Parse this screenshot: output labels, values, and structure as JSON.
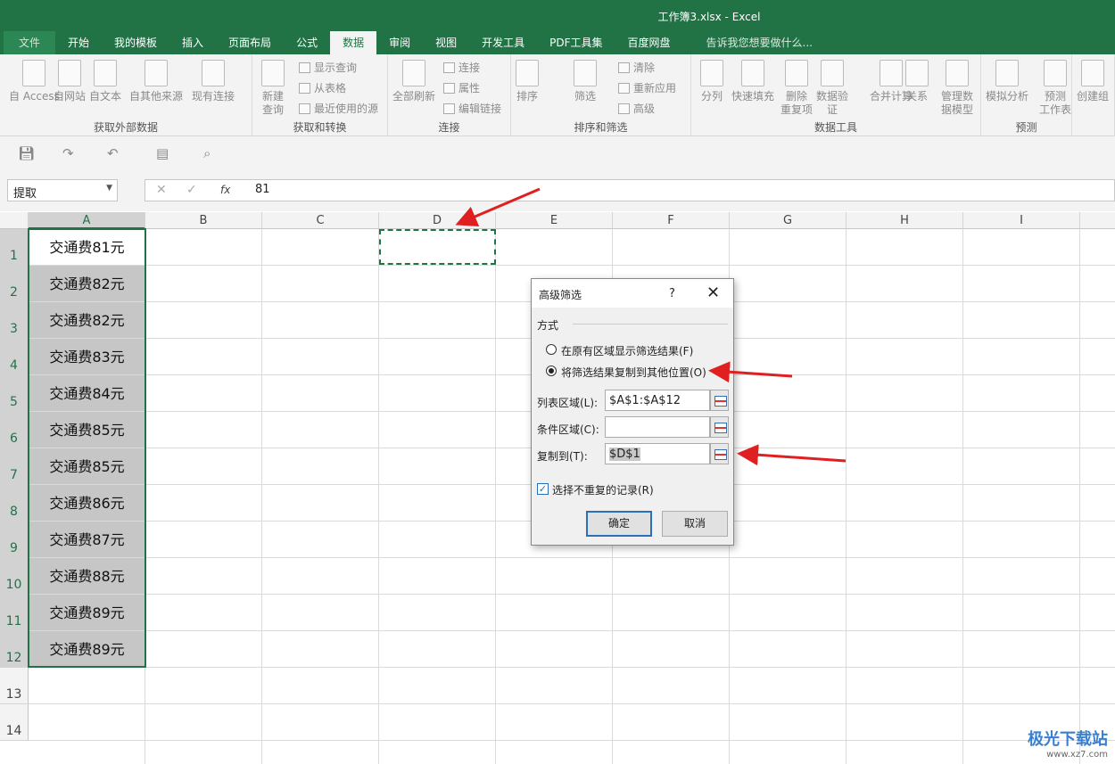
{
  "window": {
    "title": "工作簿3.xlsx - Excel"
  },
  "tabs": [
    "文件",
    "开始",
    "我的模板",
    "插入",
    "页面布局",
    "公式",
    "数据",
    "审阅",
    "视图",
    "开发工具",
    "PDF工具集",
    "百度网盘"
  ],
  "active_tab": "数据",
  "tell_me": "告诉我您想要做什么...",
  "ribbon": {
    "groups": [
      {
        "label": "获取外部数据",
        "buttons": [
          "自 Access",
          "自网站",
          "自文本",
          "自其他来源",
          "现有连接"
        ]
      },
      {
        "label": "获取和转换",
        "buttons": [
          "新建\n查询"
        ],
        "small": [
          "显示查询",
          "从表格",
          "最近使用的源"
        ]
      },
      {
        "label": "连接",
        "buttons": [
          "全部刷新"
        ],
        "small": [
          "连接",
          "属性",
          "编辑链接"
        ]
      },
      {
        "label": "排序和筛选",
        "buttons": [
          "排序",
          "筛选"
        ],
        "small": [
          "清除",
          "重新应用",
          "高级"
        ]
      },
      {
        "label": "数据工具",
        "buttons": [
          "分列",
          "快速填充",
          "删除\n重复项",
          "数据验\n证",
          "合并计算",
          "关系",
          "管理数\n据模型"
        ]
      },
      {
        "label": "预测",
        "buttons": [
          "模拟分析",
          "预测\n工作表"
        ]
      },
      {
        "label": "",
        "buttons": [
          "创建组"
        ]
      }
    ]
  },
  "formula_bar": {
    "name_box": "提取",
    "fx": "fx",
    "value": "81"
  },
  "columns": [
    "A",
    "B",
    "C",
    "D",
    "E",
    "F",
    "G",
    "H",
    "I"
  ],
  "rows": [
    "1",
    "2",
    "3",
    "4",
    "5",
    "6",
    "7",
    "8",
    "9",
    "10",
    "11",
    "12",
    "13",
    "14"
  ],
  "column_a": [
    "交通费81元",
    "交通费82元",
    "交通费82元",
    "交通费83元",
    "交通费84元",
    "交通费85元",
    "交通费85元",
    "交通费86元",
    "交通费87元",
    "交通费88元",
    "交通费89元",
    "交通费89元"
  ],
  "dialog": {
    "title": "高级筛选",
    "help": "?",
    "close": "✕",
    "section": "方式",
    "radio1": "在原有区域显示筛选结果(F)",
    "radio2": "将筛选结果复制到其他位置(O)",
    "selected_radio": 2,
    "list_range_label": "列表区域(L):",
    "list_range": "$A$1:$A$12",
    "criteria_label": "条件区域(C):",
    "criteria": "",
    "copy_to_label": "复制到(T):",
    "copy_to": "$D$1",
    "unique_label": "选择不重复的记录(R)",
    "unique_checked": true,
    "ok": "确定",
    "cancel": "取消"
  },
  "watermark": {
    "name": "极光下载站",
    "url": "www.xz7.com"
  },
  "colors": {
    "excel_green": "#217346",
    "annotation_arrow": "#e02020"
  }
}
